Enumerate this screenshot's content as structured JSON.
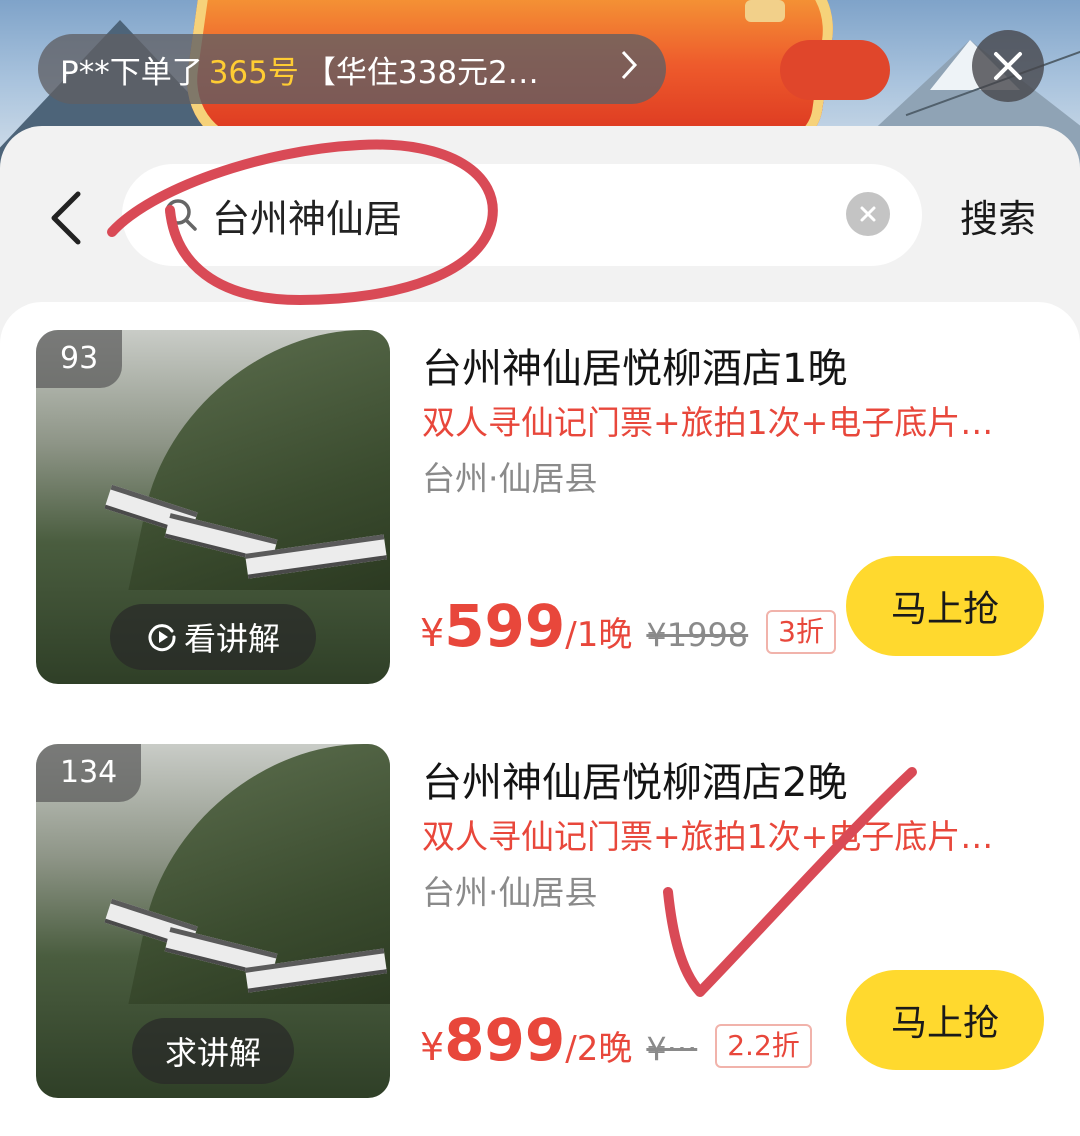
{
  "ticker": {
    "prefix": "P**下单了",
    "highlight": "365号",
    "suffix": "【华住338元2…"
  },
  "search": {
    "query": "台州神仙居",
    "submit_label": "搜索"
  },
  "products": [
    {
      "rank": "93",
      "title": "台州神仙居悦柳酒店1晚",
      "subtitle": "双人寻仙记门票+旅拍1次+电子底片…",
      "location": "台州·仙居县",
      "currency": "¥",
      "price": "599",
      "unit": "/1晚",
      "original_price": "¥1998",
      "discount": "3折",
      "explain_label": "看讲解",
      "buy_label": "马上抢"
    },
    {
      "rank": "134",
      "title": "台州神仙居悦柳酒店2晚",
      "subtitle": "双人寻仙记门票+旅拍1次+电子底片…",
      "location": "台州·仙居县",
      "currency": "¥",
      "price": "899",
      "unit": "/2晚",
      "original_price": "¥···",
      "discount": "2.2折",
      "explain_label": "求讲解",
      "buy_label": "马上抢"
    }
  ],
  "colors": {
    "accent_red": "#e8473b",
    "buy_yellow": "#ffd92e",
    "highlight_yellow": "#ffcc33",
    "annotation_red": "#d94a56"
  },
  "icons": [
    "close-icon",
    "back-chevron-icon",
    "search-icon",
    "clear-icon",
    "play-circle-icon",
    "chevron-right-icon"
  ]
}
